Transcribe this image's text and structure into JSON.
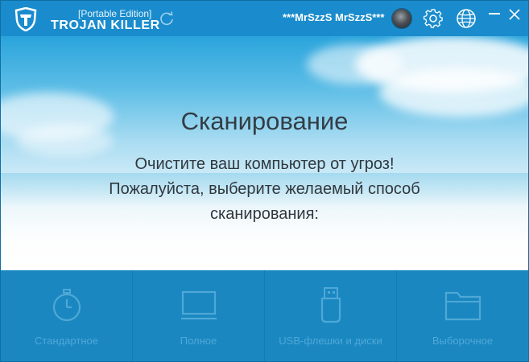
{
  "titlebar": {
    "edition": "[Portable Edition]",
    "brand": "TROJAN KILLER",
    "username": "***MrSzzS MrSzzS***",
    "icons": {
      "logo": "shield-logo-icon",
      "refresh": "refresh-icon",
      "avatar": "user-avatar",
      "settings": "gear-icon",
      "language": "globe-icon",
      "minimize": "minimize-icon",
      "close": "close-icon"
    }
  },
  "hero": {
    "title": "Сканирование",
    "line1": "Очистите ваш компьютер от угроз!",
    "line2": "Пожалуйста, выберите желаемый способ",
    "line3": "сканирования:"
  },
  "options": [
    {
      "label": "Стандартное",
      "icon": "stopwatch-icon"
    },
    {
      "label": "Полное",
      "icon": "monitor-icon"
    },
    {
      "label": "USB-флешки и диски",
      "icon": "usb-drive-icon"
    },
    {
      "label": "Выборочное",
      "icon": "folder-icon"
    }
  ],
  "colors": {
    "titlebar": "#1a8ccd",
    "options_bg": "#1a87c1",
    "option_icon": "#4fa8d6"
  }
}
